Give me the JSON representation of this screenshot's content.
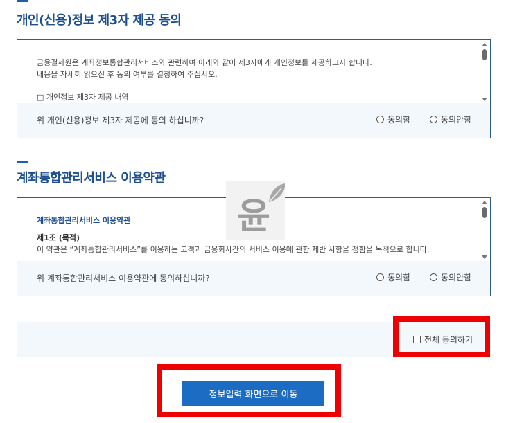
{
  "section1": {
    "title": "개인(신용)정보 제3자 제공 동의",
    "lines": [
      "금융결제원은 계좌정보통합관리서비스와 관련하여 아래와 같이 제3자에게 개인정보를 제공하고자 합니다.",
      "내용을 자세히 읽으신 후 동의 여부를 결정하여 주십시오.",
      "□ 개인정보 제3자 제공 내역"
    ],
    "question": "위 개인(신용)정보 제3자 제공에 동의 하십니까?",
    "agree_label": "동의함",
    "disagree_label": "동의안함"
  },
  "section2": {
    "title": "계좌통합관리서비스 이용약관",
    "heading": "계좌통합관리서비스 이용약관",
    "article": "제1조 (목적)",
    "body": "이 약관은 “계좌통합관리서비스”를 이용하는 고객과 금융회사간의 서비스 이용에 관한 제반 사항을 정함을 목적으로 합니다.",
    "question": "위 계좌통합관리서비스 이용약관에 동의하십니까?",
    "agree_label": "동의함",
    "disagree_label": "동의안함"
  },
  "all_agree_label": "전체 동의하기",
  "submit_label": "정보입력 화면으로 이동",
  "watermark_char": "윤",
  "colors": {
    "title": "#1d4f91",
    "accent": "#1a5fb4",
    "panel_border": "#2f5d8a",
    "question_bg": "#f3f8fc",
    "button": "#1d6cc4",
    "highlight": "#ee0000"
  }
}
